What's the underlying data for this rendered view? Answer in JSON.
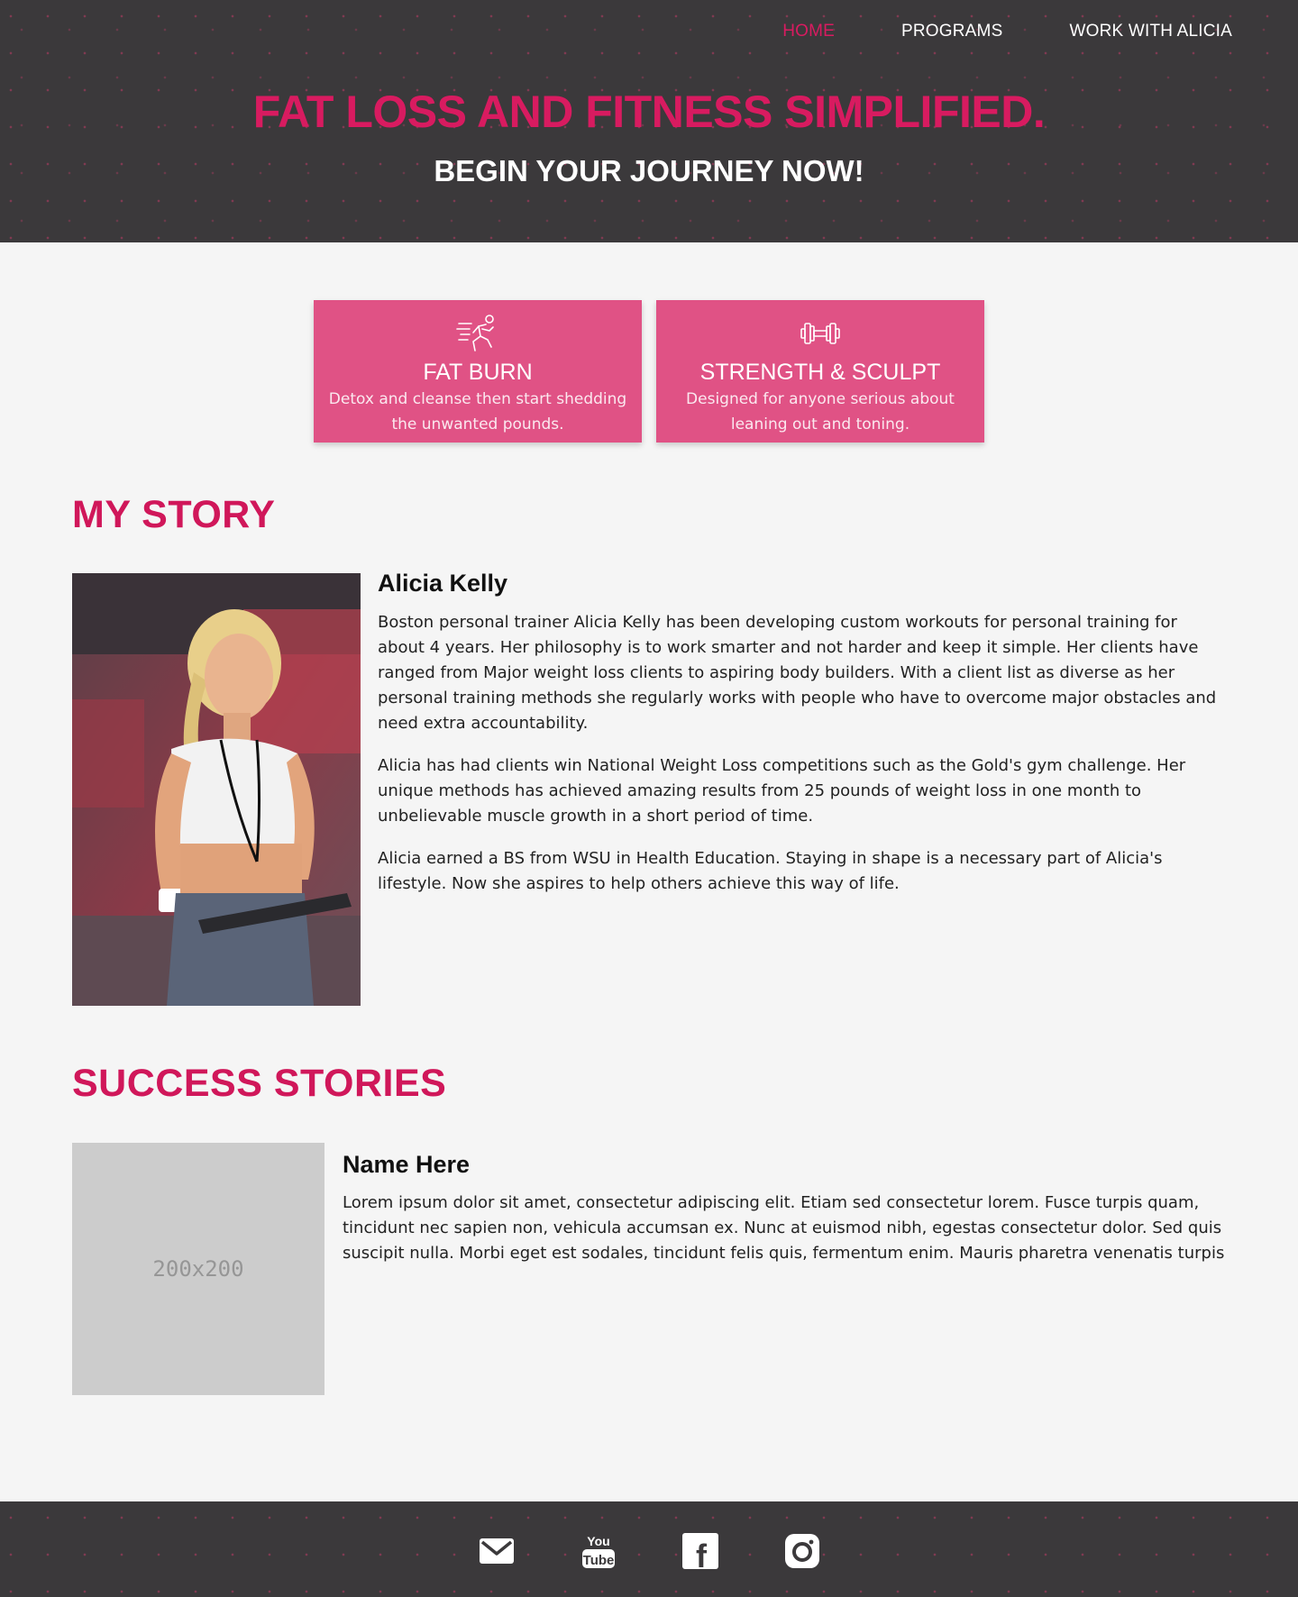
{
  "nav": {
    "items": [
      {
        "label": "HOME",
        "active": true
      },
      {
        "label": "PROGRAMS",
        "active": false
      },
      {
        "label": "WORK WITH ALICIA",
        "active": false
      }
    ]
  },
  "hero": {
    "title": "FAT LOSS AND FITNESS SIMPLIFIED.",
    "subtitle": "BEGIN YOUR JOURNEY NOW!"
  },
  "programs": [
    {
      "icon": "running-person-icon",
      "title": "FAT BURN",
      "description": "Detox and cleanse then start shedding the unwanted pounds."
    },
    {
      "icon": "dumbbell-icon",
      "title": "STRENGTH & SCULPT",
      "description": "Designed for anyone serious about leaning out and toning."
    }
  ],
  "story": {
    "heading": "MY STORY",
    "name": "Alicia Kelly",
    "paragraphs": [
      "Boston personal trainer Alicia Kelly has been developing custom workouts for personal training for about 4 years. Her philosophy is to work smarter and not harder and keep it simple. Her clients have ranged from Major weight loss clients to aspiring body builders. With a client list as diverse as her personal training methods she regularly works with people who have to overcome major obstacles and need extra accountability.",
      "Alicia has had clients win National Weight Loss competitions such as the Gold's gym challenge. Her unique methods has achieved amazing results from 25 pounds of weight loss in one month to unbelievable muscle growth in a short period of time.",
      "Alicia earned a BS from WSU in Health Education. Staying in shape is a necessary part of Alicia's lifestyle. Now she aspires to help others achieve this way of life."
    ]
  },
  "success": {
    "heading": "SUCCESS STORIES",
    "placeholder_label": "200x200",
    "name": "Name Here",
    "text": "Lorem ipsum dolor sit amet, consectetur adipiscing elit. Etiam sed consectetur lorem. Fusce turpis quam, tincidunt nec sapien non, vehicula accumsan ex. Nunc at euismod nibh, egestas consectetur dolor. Sed quis suscipit nulla. Morbi eget est sodales, tincidunt felis quis, fermentum enim. Mauris pharetra venenatis turpis"
  },
  "footer": {
    "social": [
      {
        "icon": "email-icon"
      },
      {
        "icon": "youtube-icon",
        "text_top": "You",
        "text_bottom": "Tube"
      },
      {
        "icon": "facebook-icon",
        "text": "f"
      },
      {
        "icon": "instagram-icon"
      }
    ]
  },
  "colors": {
    "accent": "#d81b60",
    "card": "#e05285",
    "header_bg": "#3b393b",
    "page_bg": "#f5f5f5",
    "placeholder_bg": "#cccccc"
  }
}
